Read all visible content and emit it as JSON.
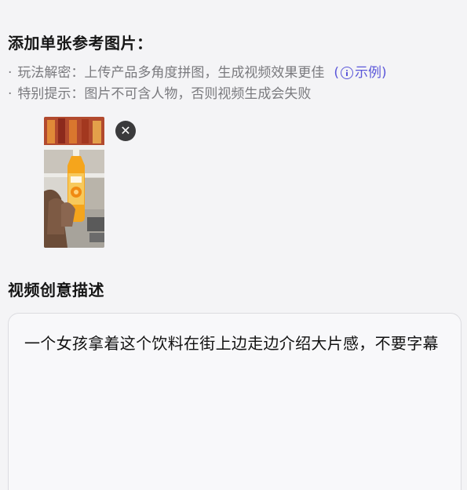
{
  "upload": {
    "title": "添加单张参考图片：",
    "tips": [
      {
        "bullet": "·",
        "text": "玩法解密：上传产品多角度拼图，生成视频效果更佳"
      },
      {
        "bullet": "·",
        "text": "特别提示：图片不可含人物，否则视频生成会失败"
      }
    ],
    "example_open": "(",
    "example_label": "示例",
    "example_close": ")",
    "example_icon": "info-icon",
    "remove_icon": "close-icon",
    "remove_glyph": "✕"
  },
  "description": {
    "title": "视频创意描述",
    "value": "一个女孩拿着这个饮料在街上边走边介绍大片感，不要字幕"
  },
  "colors": {
    "accent": "#5b57d9",
    "tip_text": "#7a7a7e",
    "background": "#f4f4f6"
  }
}
